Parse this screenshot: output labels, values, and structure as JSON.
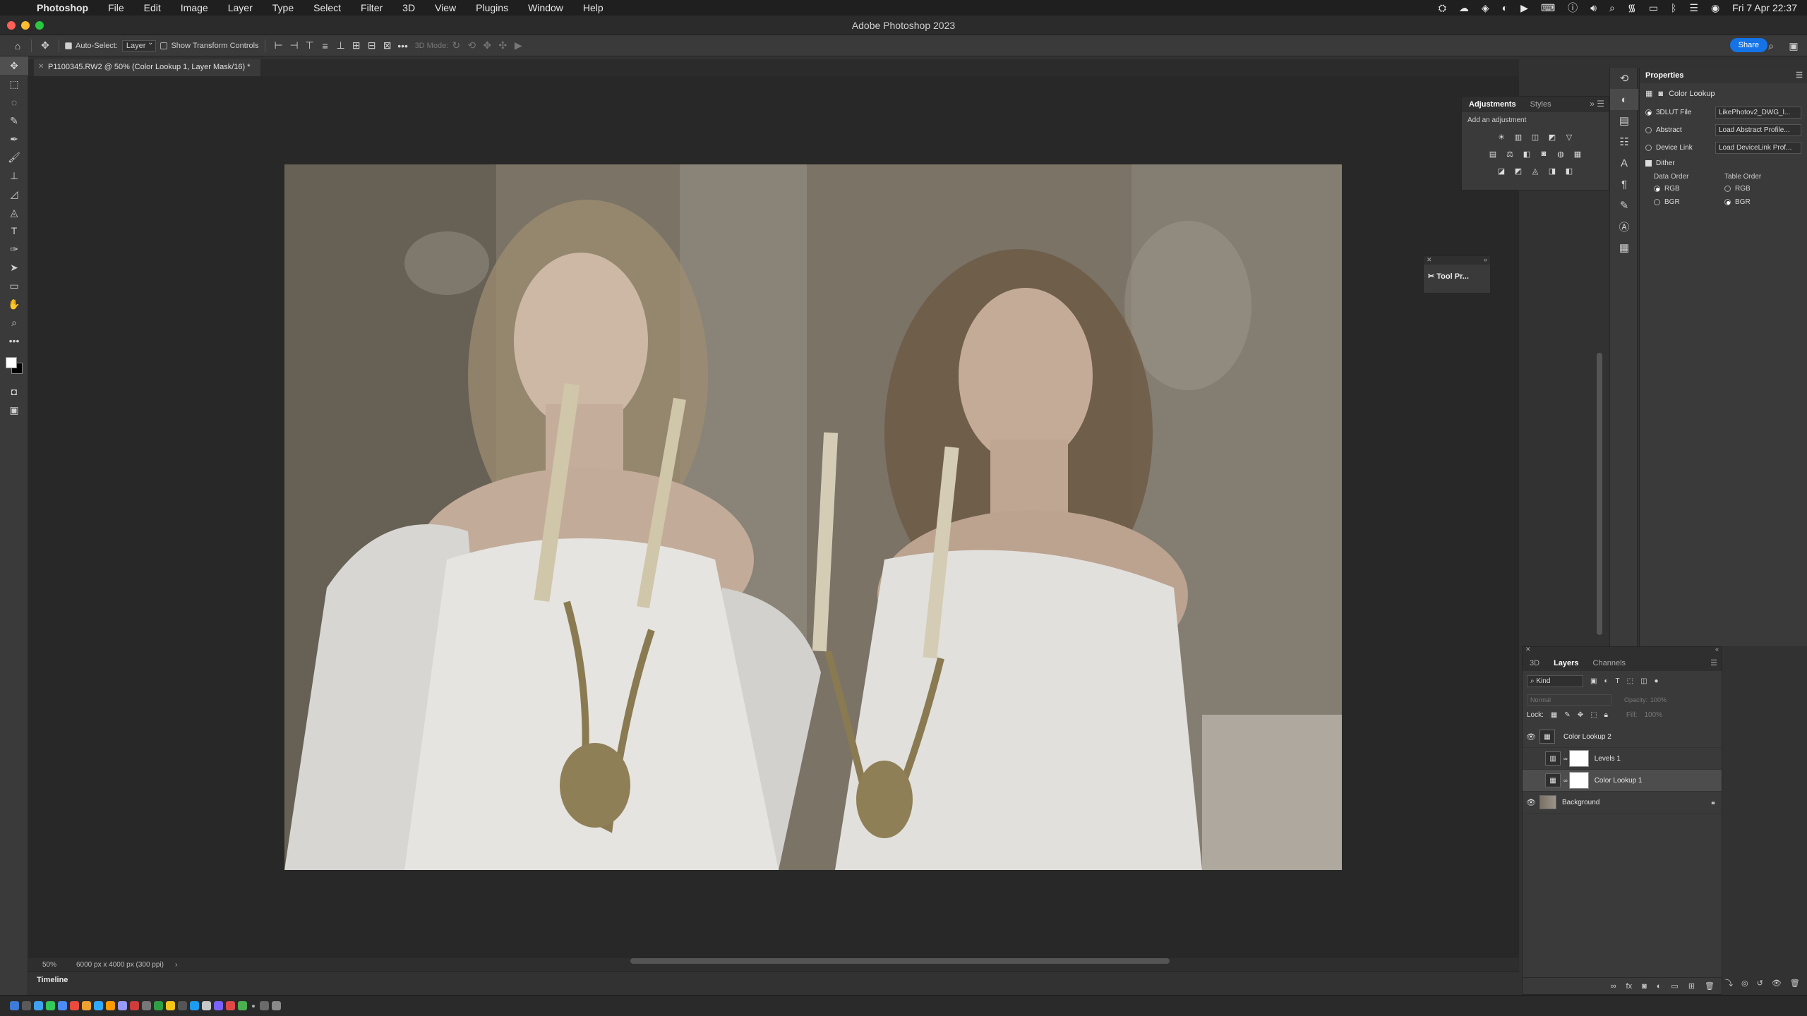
{
  "menubar": {
    "app_name": "Photoshop",
    "menus": [
      "File",
      "Edit",
      "Image",
      "Layer",
      "Type",
      "Select",
      "Filter",
      "3D",
      "View",
      "Plugins",
      "Window",
      "Help"
    ],
    "datetime": "Fri 7 Apr 22:37"
  },
  "window": {
    "title": "Adobe Photoshop 2023"
  },
  "options_bar": {
    "auto_select_label": "Auto-Select:",
    "auto_select_checked": true,
    "auto_select_target": "Layer",
    "show_transform_label": "Show Transform Controls",
    "mode_3d_label": "3D Mode:",
    "share_label": "Share"
  },
  "document": {
    "tab_title": "P1100345.RW2 @ 50% (Color Lookup 1, Layer Mask/16) *",
    "zoom": "50%",
    "dimensions": "6000 px x 4000 px (300 ppi)"
  },
  "timeline": {
    "tab_label": "Timeline"
  },
  "adjustments": {
    "tabs": [
      "Adjustments",
      "Styles"
    ],
    "hint": "Add an adjustment",
    "row1": [
      "☀",
      "▥",
      "◫",
      "◩",
      "▽"
    ],
    "row2": [
      "▤",
      "⚖",
      "◧",
      "◙",
      "◍",
      "▦"
    ],
    "row3": [
      "◪",
      "◩",
      "◬",
      "◨",
      "◧"
    ]
  },
  "tool_presets": {
    "label": "Tool Pr..."
  },
  "properties": {
    "title": "Properties",
    "subtitle": "Color Lookup",
    "lut_file_label": "3DLUT File",
    "lut_file_value": "LikePhotov2_DWG_l...",
    "abstract_label": "Abstract",
    "abstract_value": "Load Abstract Profile...",
    "device_link_label": "Device Link",
    "device_link_value": "Load DeviceLink Prof...",
    "dither_label": "Dither",
    "data_order_label": "Data Order",
    "table_order_label": "Table Order",
    "rgb_label": "RGB",
    "bgr_label": "BGR"
  },
  "layers_panel": {
    "tabs": [
      "3D",
      "Layers",
      "Channels"
    ],
    "filter_kind": "Kind",
    "blend_mode": "Normal",
    "opacity_label": "Opacity:",
    "opacity_value": "100%",
    "lock_label": "Lock:",
    "fill_label": "Fill:",
    "fill_value": "100%",
    "layers": [
      {
        "name": "Color Lookup 2",
        "visible": true
      },
      {
        "name": "Levels 1",
        "visible": false
      },
      {
        "name": "Color Lookup 1",
        "visible": false,
        "selected": true
      },
      {
        "name": "Background",
        "visible": true,
        "locked": true
      }
    ]
  },
  "colors": {
    "foreground": "#ffffff",
    "background": "#000000",
    "accent": "#1473e6"
  }
}
